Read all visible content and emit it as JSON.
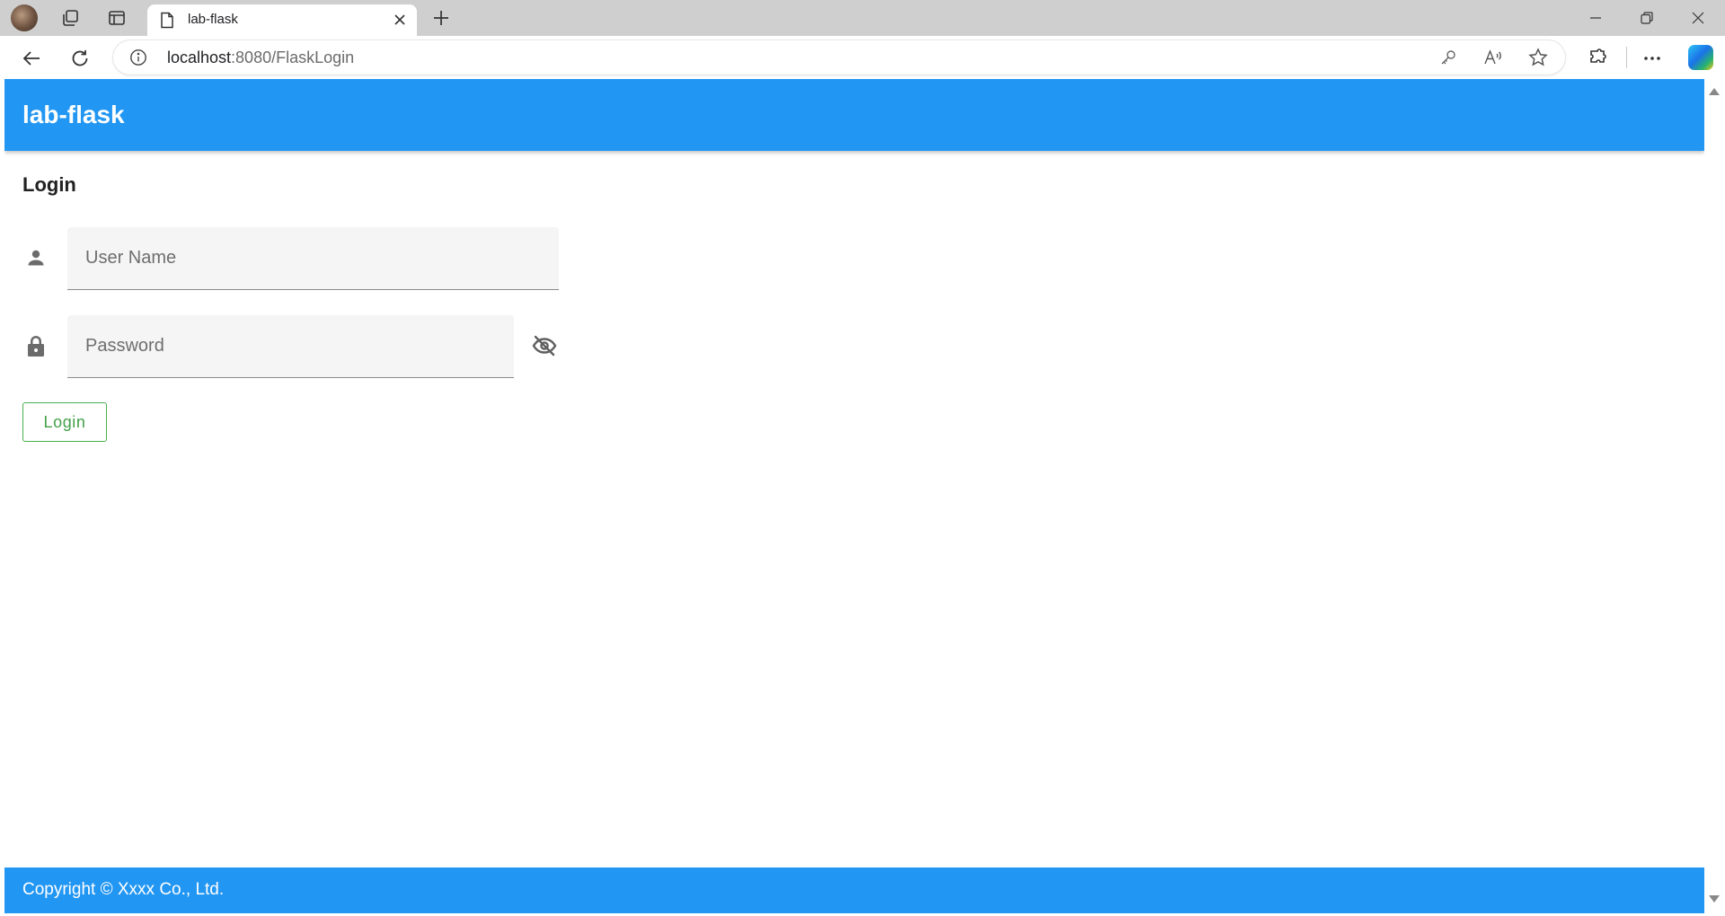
{
  "browser": {
    "tab": {
      "title": "lab-flask",
      "close_icon": "close-icon",
      "favicon": "page-icon"
    },
    "address_bar": {
      "host": "localhost",
      "path": ":8080/FlaskLogin"
    }
  },
  "app": {
    "title": "lab-flask",
    "colors": {
      "primary": "#2196f3",
      "accent": "#4caf50"
    }
  },
  "login_form": {
    "heading": "Login",
    "username": {
      "placeholder": "User Name",
      "value": "",
      "icon": "person-icon"
    },
    "password": {
      "placeholder": "Password",
      "value": "",
      "icon": "lock-icon",
      "visibility_icon": "eye-off-icon"
    },
    "submit_label": "Login"
  },
  "footer": {
    "text": "Copyright © Xxxx Co., Ltd."
  }
}
